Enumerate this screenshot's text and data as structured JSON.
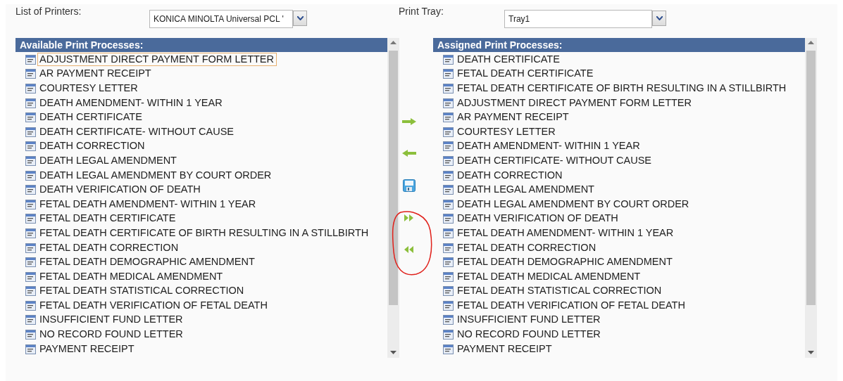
{
  "printer": {
    "label": "List of Printers:",
    "value": "KONICA MINOLTA Universal PCL '"
  },
  "tray": {
    "label": "Print Tray:",
    "value": "Tray1"
  },
  "available": {
    "title": "Available Print Processes:",
    "items": [
      {
        "label": "ADJUSTMENT DIRECT PAYMENT FORM LETTER",
        "focused": true
      },
      {
        "label": "AR PAYMENT RECEIPT",
        "focused": false
      },
      {
        "label": "COURTESY LETTER",
        "focused": false
      },
      {
        "label": "DEATH AMENDMENT- WITHIN 1 YEAR",
        "focused": false
      },
      {
        "label": "DEATH CERTIFICATE",
        "focused": false
      },
      {
        "label": "DEATH CERTIFICATE- WITHOUT CAUSE",
        "focused": false
      },
      {
        "label": "DEATH CORRECTION",
        "focused": false
      },
      {
        "label": "DEATH LEGAL AMENDMENT",
        "focused": false
      },
      {
        "label": "DEATH LEGAL AMENDMENT BY COURT ORDER",
        "focused": false
      },
      {
        "label": "DEATH VERIFICATION OF DEATH",
        "focused": false
      },
      {
        "label": "FETAL DEATH AMENDMENT- WITHIN 1 YEAR",
        "focused": false
      },
      {
        "label": "FETAL DEATH CERTIFICATE",
        "focused": false
      },
      {
        "label": "FETAL DEATH CERTIFICATE OF BIRTH RESULTING IN A STILLBIRTH",
        "focused": false
      },
      {
        "label": "FETAL DEATH CORRECTION",
        "focused": false
      },
      {
        "label": "FETAL DEATH DEMOGRAPHIC AMENDMENT",
        "focused": false
      },
      {
        "label": "FETAL DEATH MEDICAL AMENDMENT",
        "focused": false
      },
      {
        "label": "FETAL DEATH STATISTICAL CORRECTION",
        "focused": false
      },
      {
        "label": "FETAL DEATH VERIFICATION OF FETAL DEATH",
        "focused": false
      },
      {
        "label": "INSUFFICIENT FUND LETTER",
        "focused": false
      },
      {
        "label": "NO RECORD FOUND LETTER",
        "focused": false
      },
      {
        "label": "PAYMENT RECEIPT",
        "focused": false
      }
    ]
  },
  "actions": [
    {
      "kind": "right"
    },
    {
      "kind": "left"
    },
    {
      "kind": "save"
    },
    {
      "kind": "all-right"
    },
    {
      "kind": "all-left"
    }
  ],
  "assigned": {
    "title": "Assigned Print Processes:",
    "items": [
      {
        "label": "DEATH CERTIFICATE",
        "focused": false
      },
      {
        "label": "FETAL DEATH CERTIFICATE",
        "focused": false
      },
      {
        "label": "FETAL DEATH CERTIFICATE OF BIRTH RESULTING IN A STILLBIRTH",
        "focused": false
      },
      {
        "label": "ADJUSTMENT DIRECT PAYMENT FORM LETTER",
        "focused": false
      },
      {
        "label": "AR PAYMENT RECEIPT",
        "focused": false
      },
      {
        "label": "COURTESY LETTER",
        "focused": false
      },
      {
        "label": "DEATH AMENDMENT- WITHIN 1 YEAR",
        "focused": false
      },
      {
        "label": "DEATH CERTIFICATE- WITHOUT CAUSE",
        "focused": false
      },
      {
        "label": "DEATH CORRECTION",
        "focused": false
      },
      {
        "label": "DEATH LEGAL AMENDMENT",
        "focused": false
      },
      {
        "label": "DEATH LEGAL AMENDMENT BY COURT ORDER",
        "focused": false
      },
      {
        "label": "DEATH VERIFICATION OF DEATH",
        "focused": false
      },
      {
        "label": "FETAL DEATH AMENDMENT- WITHIN 1 YEAR",
        "focused": false
      },
      {
        "label": "FETAL DEATH CORRECTION",
        "focused": false
      },
      {
        "label": "FETAL DEATH DEMOGRAPHIC AMENDMENT",
        "focused": false
      },
      {
        "label": "FETAL DEATH MEDICAL AMENDMENT",
        "focused": false
      },
      {
        "label": "FETAL DEATH STATISTICAL CORRECTION",
        "focused": false
      },
      {
        "label": "FETAL DEATH VERIFICATION OF FETAL DEATH",
        "focused": false
      },
      {
        "label": "INSUFFICIENT FUND LETTER",
        "focused": false
      },
      {
        "label": "NO RECORD FOUND LETTER",
        "focused": false
      },
      {
        "label": "PAYMENT RECEIPT",
        "focused": false
      }
    ]
  }
}
